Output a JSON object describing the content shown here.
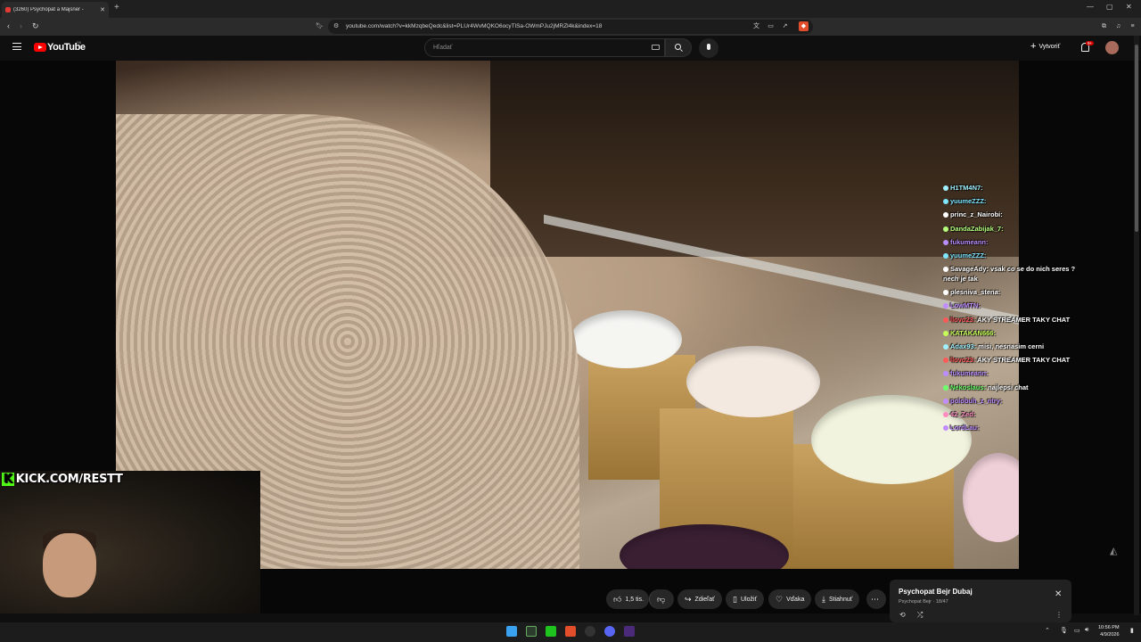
{
  "browser": {
    "tab_title": "(3260) Psychopat a Majsner - ",
    "url": "youtube.com/watch?v=kkMzqbeQedc&list=PLUr4WvMQKO6ocyTlSa-OWmPJu2jMRZl4k&index=18"
  },
  "youtube": {
    "logo_text": "YouTube",
    "country_code": "SK",
    "search_placeholder": "Hľadať",
    "create_label": "Vytvoriť",
    "notif_count": "9+"
  },
  "overlay": {
    "kick_text": "KICK.COM/RESTT"
  },
  "chat": [
    {
      "user": "H1TM4N7:",
      "msg": "",
      "color": "#a0f0ff"
    },
    {
      "user": "yuumeZZZ:",
      "msg": "",
      "color": "#7ee6ff"
    },
    {
      "user": "princ_z_Nairobi:",
      "msg": "",
      "color": "#ffffff"
    },
    {
      "user": "DandaZabijak_7:",
      "msg": "",
      "color": "#b6ff7e"
    },
    {
      "user": "fukumeann:",
      "msg": "",
      "color": "#b98cff"
    },
    {
      "user": "yuumeZZZ:",
      "msg": "",
      "color": "#7ee6ff"
    },
    {
      "user": "SavageAdy:",
      "msg": "vsak co se do nich seres ? nech je tak",
      "color": "#ffffff"
    },
    {
      "user": "plesniva_stena:",
      "msg": "",
      "color": "#ffffff"
    },
    {
      "user": "LowMTN:",
      "msg": "",
      "color": "#c08cff"
    },
    {
      "user": "llovo23:",
      "msg": "AKY STREAMER TAKY CHAT",
      "color": "#ff5a5a"
    },
    {
      "user": "KATAKAN666:",
      "msg": "",
      "color": "#c6ff59"
    },
    {
      "user": "Adax93:",
      "msg": "misi, nesnasim cerni",
      "color": "#a0f0ff"
    },
    {
      "user": "llovo23:",
      "msg": "AKY STREAMER TAKY CHAT",
      "color": "#ff5a5a"
    },
    {
      "user": "fukumeann:",
      "msg": "",
      "color": "#b98cff"
    },
    {
      "user": "Nekoslaus:",
      "msg": "najlepsi chat",
      "color": "#6bff6b"
    },
    {
      "user": "polobuh_z_ntry:",
      "msg": "",
      "color": "#c08cff"
    },
    {
      "user": "42_Zed:",
      "msg": "",
      "color": "#ff8cc0"
    },
    {
      "user": "LordLau:",
      "msg": "",
      "color": "#c08cff"
    }
  ],
  "actions": {
    "like_count": "1,5 tis.",
    "share": "Zdieľať",
    "save": "Uložiť",
    "thanks": "Vďaka",
    "download": "Stiahnuť"
  },
  "miniplayer": {
    "title": "Psychopat Bejr  Dubaj",
    "subtitle": "Psychopat Bejr · 18/47"
  },
  "clock": {
    "time": "10:56 PM",
    "date": "4/9/2026"
  }
}
